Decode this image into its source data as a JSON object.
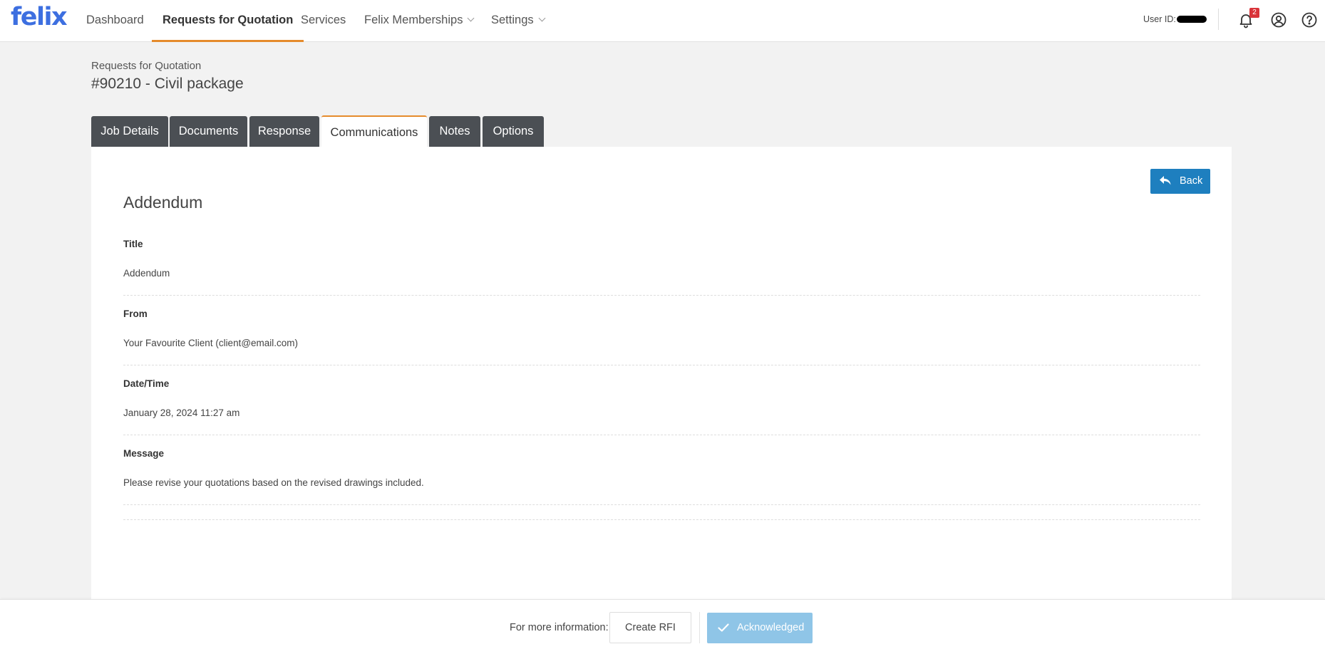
{
  "brand": {
    "logo_text": "felix",
    "logo_color": "#3d6fe0"
  },
  "nav": {
    "items": [
      {
        "label": "Dashboard",
        "active": false,
        "has_dropdown": false
      },
      {
        "label": "Requests for Quotation",
        "active": true,
        "has_dropdown": false
      },
      {
        "label": "Services",
        "active": false,
        "has_dropdown": false
      },
      {
        "label": "Felix Memberships",
        "active": false,
        "has_dropdown": true
      },
      {
        "label": "Settings",
        "active": false,
        "has_dropdown": true
      }
    ],
    "user_id_label": "User ID:",
    "notification_count": "2",
    "icons": [
      "bell-icon",
      "user-circle-icon",
      "help-circle-icon"
    ]
  },
  "page": {
    "breadcrumb": "Requests for Quotation",
    "title": "#90210 - Civil package"
  },
  "tabs": [
    {
      "label": "Job Details",
      "active": false
    },
    {
      "label": "Documents",
      "active": false
    },
    {
      "label": "Response",
      "active": false
    },
    {
      "label": "Communications",
      "active": true
    },
    {
      "label": "Notes",
      "active": false
    },
    {
      "label": "Options",
      "active": false
    }
  ],
  "communication": {
    "heading": "Addendum",
    "back_label": "Back",
    "fields": [
      {
        "label": "Title",
        "value": "Addendum"
      },
      {
        "label": "From",
        "value": "Your Favourite Client (client@email.com)"
      },
      {
        "label": "Date/Time",
        "value": "January 28, 2024 11:27 am"
      },
      {
        "label": "Message",
        "value": "Please revise your quotations based on the revised drawings included."
      }
    ]
  },
  "footer": {
    "more_info": "For more information:",
    "create_rfi": "Create RFI",
    "acknowledged": "Acknowledged"
  },
  "colors": {
    "accent": "#e58b2c",
    "tab_inactive": "#4b4f54",
    "primary_button": "#1e7fbf",
    "acknowledged_button": "#8fc5e7",
    "badge": "#d9343a"
  }
}
